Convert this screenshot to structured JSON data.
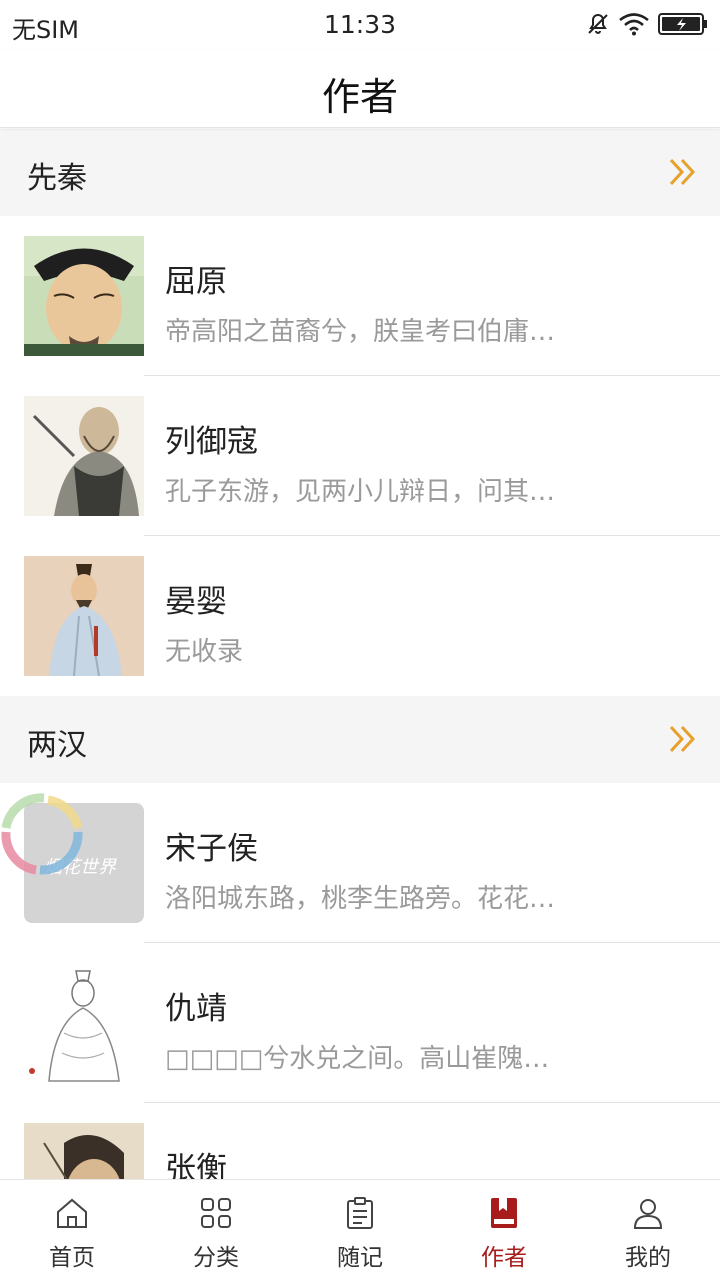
{
  "status_bar": {
    "carrier": "无SIM",
    "time": "11:33"
  },
  "nav": {
    "title": "作者"
  },
  "colors": {
    "accent": "#e8a02c",
    "tab_active": "#a81c1c",
    "section_bg": "#f5f5f5",
    "excerpt": "#9a9a9a"
  },
  "sections": [
    {
      "title": "先秦",
      "more_icon": "double-chevron-right-icon",
      "authors": [
        {
          "name": "屈原",
          "excerpt": "帝高阳之苗裔兮，朕皇考曰伯庸…"
        },
        {
          "name": "列御寇",
          "excerpt": "孔子东游，见两小儿辩日，问其…"
        },
        {
          "name": "晏婴",
          "excerpt": "无收录"
        }
      ]
    },
    {
      "title": "两汉",
      "more_icon": "double-chevron-right-icon",
      "authors": [
        {
          "name": "宋子侯",
          "excerpt": "洛阳城东路，桃李生路旁。花花…"
        },
        {
          "name": "仇靖",
          "excerpt": "□□□□兮水兑之间。高山崔隗…"
        },
        {
          "name": "张衡",
          "excerpt": ""
        }
      ]
    }
  ],
  "tabs": [
    {
      "label": "首页",
      "icon": "home-icon",
      "active": false
    },
    {
      "label": "分类",
      "icon": "grid-icon",
      "active": false
    },
    {
      "label": "随记",
      "icon": "notes-icon",
      "active": false
    },
    {
      "label": "作者",
      "icon": "book-icon",
      "active": true
    },
    {
      "label": "我的",
      "icon": "person-icon",
      "active": false
    }
  ]
}
